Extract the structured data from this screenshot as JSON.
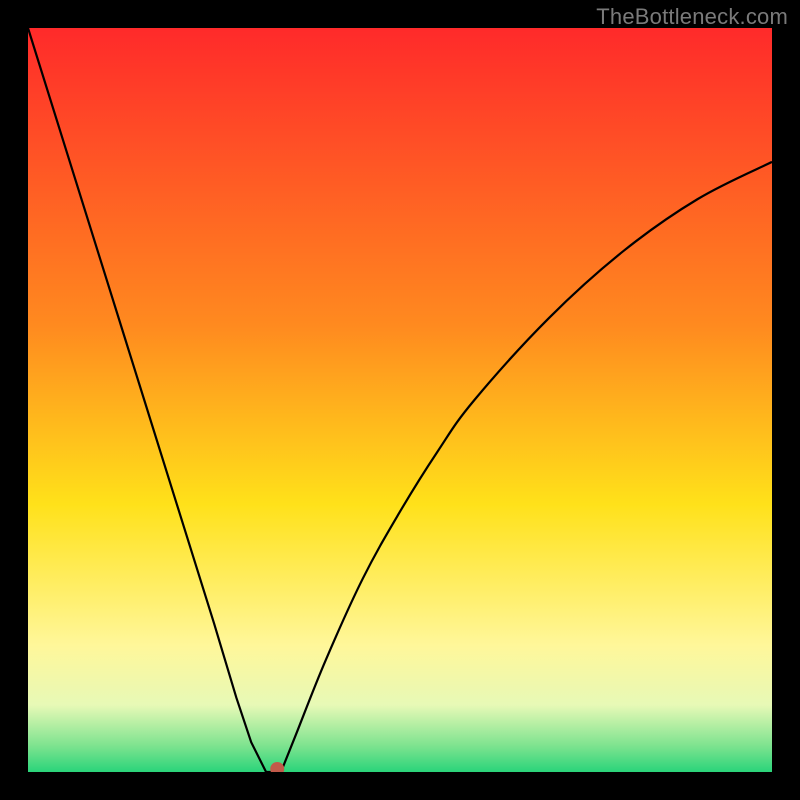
{
  "watermark": "TheBottleneck.com",
  "chart_data": {
    "type": "line",
    "title": "",
    "xlabel": "",
    "ylabel": "",
    "xlim": [
      0,
      100
    ],
    "ylim": [
      0,
      100
    ],
    "x": [
      0,
      5,
      10,
      15,
      20,
      25,
      28,
      30,
      32,
      33,
      34,
      36,
      40,
      45,
      50,
      55,
      60,
      70,
      80,
      90,
      100
    ],
    "y": [
      100,
      84,
      68,
      52,
      36,
      20,
      10,
      4,
      0,
      0,
      0,
      5,
      15,
      26,
      35,
      43,
      50,
      61,
      70,
      77,
      82
    ],
    "vertex_x": 32,
    "marker": {
      "x": 33.5,
      "y": 0,
      "color": "#c25a4a"
    },
    "gradient_colors": [
      {
        "pos": 0.0,
        "color": "#ff2a2a"
      },
      {
        "pos": 0.4,
        "color": "#ff8a1f"
      },
      {
        "pos": 0.64,
        "color": "#ffe11a"
      },
      {
        "pos": 0.83,
        "color": "#fff79a"
      },
      {
        "pos": 0.91,
        "color": "#e7f9b6"
      },
      {
        "pos": 0.965,
        "color": "#7de38f"
      },
      {
        "pos": 1.0,
        "color": "#2ad47a"
      }
    ]
  }
}
